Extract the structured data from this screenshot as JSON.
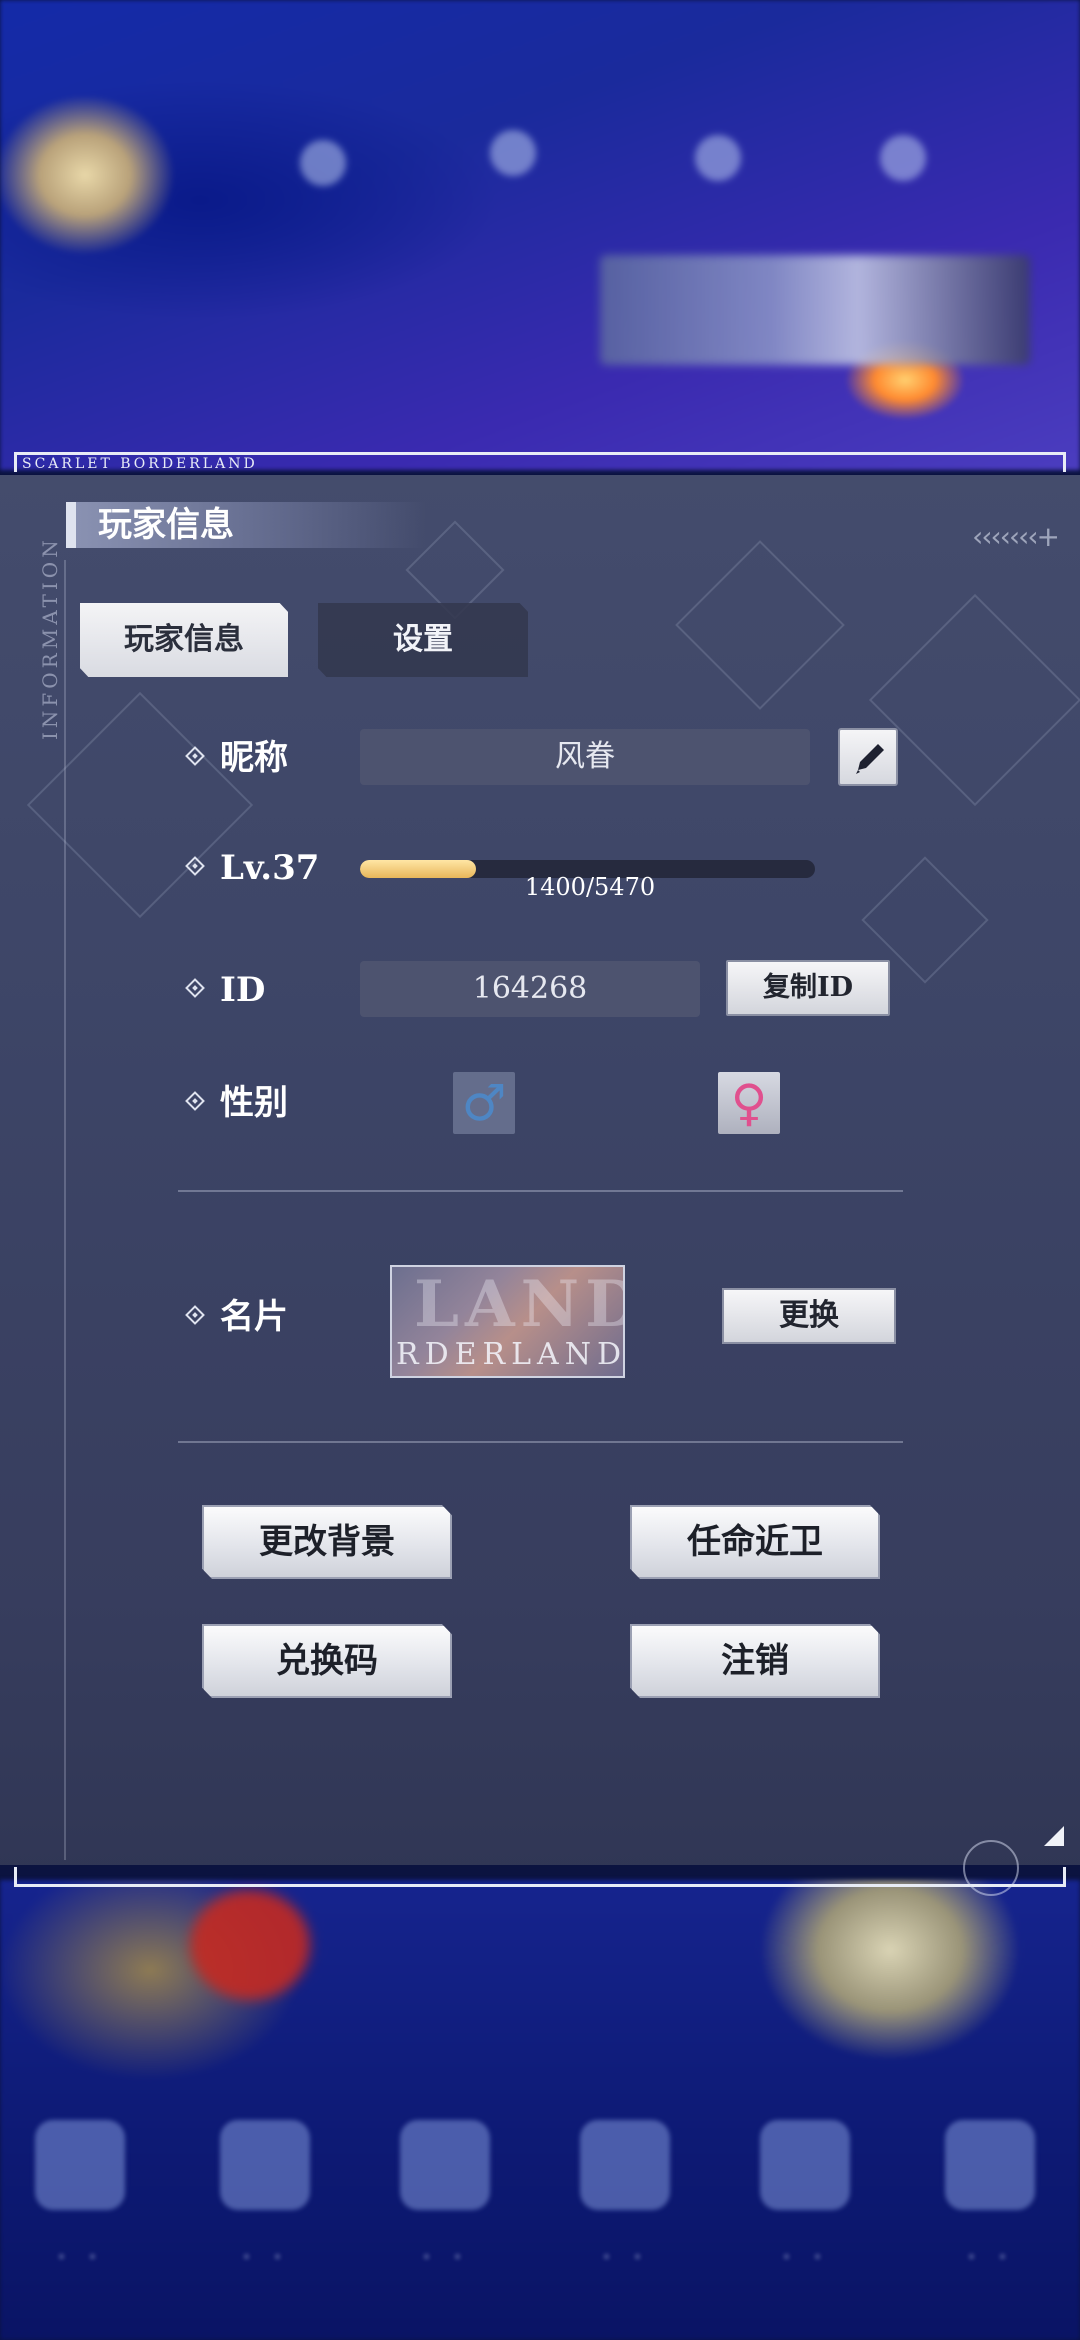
{
  "brand_strip": "SCARLET BORDERLAND",
  "side_label": "INFORMATION",
  "panel": {
    "title": "玩家信息"
  },
  "tabs": [
    {
      "label": "玩家信息",
      "active": true
    },
    {
      "label": "设置",
      "active": false
    }
  ],
  "nickname": {
    "label": "昵称",
    "value": "风眷"
  },
  "level": {
    "label": "Lv.37",
    "xp_text": "1400/5470",
    "progress_fraction": 0.256
  },
  "id": {
    "label": "ID",
    "value": "164268",
    "copy_button": "复制ID"
  },
  "gender": {
    "label": "性别",
    "male_icon": "♂",
    "female_icon": "♀",
    "selected": "female"
  },
  "card": {
    "label": "名片",
    "thumb_text_big": "LAND",
    "thumb_text_small": "RDERLAND",
    "change_button": "更换"
  },
  "actions": {
    "change_background": "更改背景",
    "appoint_guard": "任命近卫",
    "redeem_code": "兑换码",
    "logout": "注销"
  },
  "colors": {
    "xp_fill": "#e8b65a",
    "female_icon": "#e0508e",
    "male_icon": "#4e86c4",
    "panel_bg": "#464e6e"
  }
}
